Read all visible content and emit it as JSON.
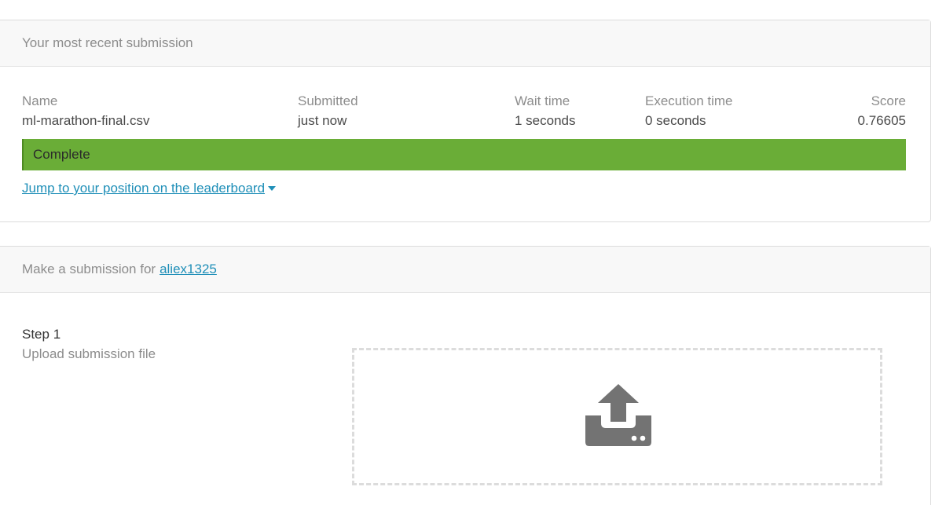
{
  "recent": {
    "header": "Your most recent submission",
    "columns": {
      "name_label": "Name",
      "submitted_label": "Submitted",
      "wait_label": "Wait time",
      "exec_label": "Execution time",
      "score_label": "Score"
    },
    "row": {
      "name": "ml-marathon-final.csv",
      "submitted": "just now",
      "wait": "1 seconds",
      "exec": "0 seconds",
      "score": "0.76605"
    },
    "status": {
      "label": "Complete",
      "color": "#6aad37",
      "progress": 1.0
    },
    "jump_link": "Jump to your position on the leaderboard"
  },
  "make": {
    "header_prefix": "Make a submission for",
    "user": "aliex1325",
    "step1": {
      "title": "Step 1",
      "subtitle": "Upload submission file"
    },
    "dropzone_icon": "upload-icon"
  },
  "colors": {
    "link": "#1f8fb8",
    "muted_text": "#8c8c8c",
    "icon": "#737373"
  }
}
